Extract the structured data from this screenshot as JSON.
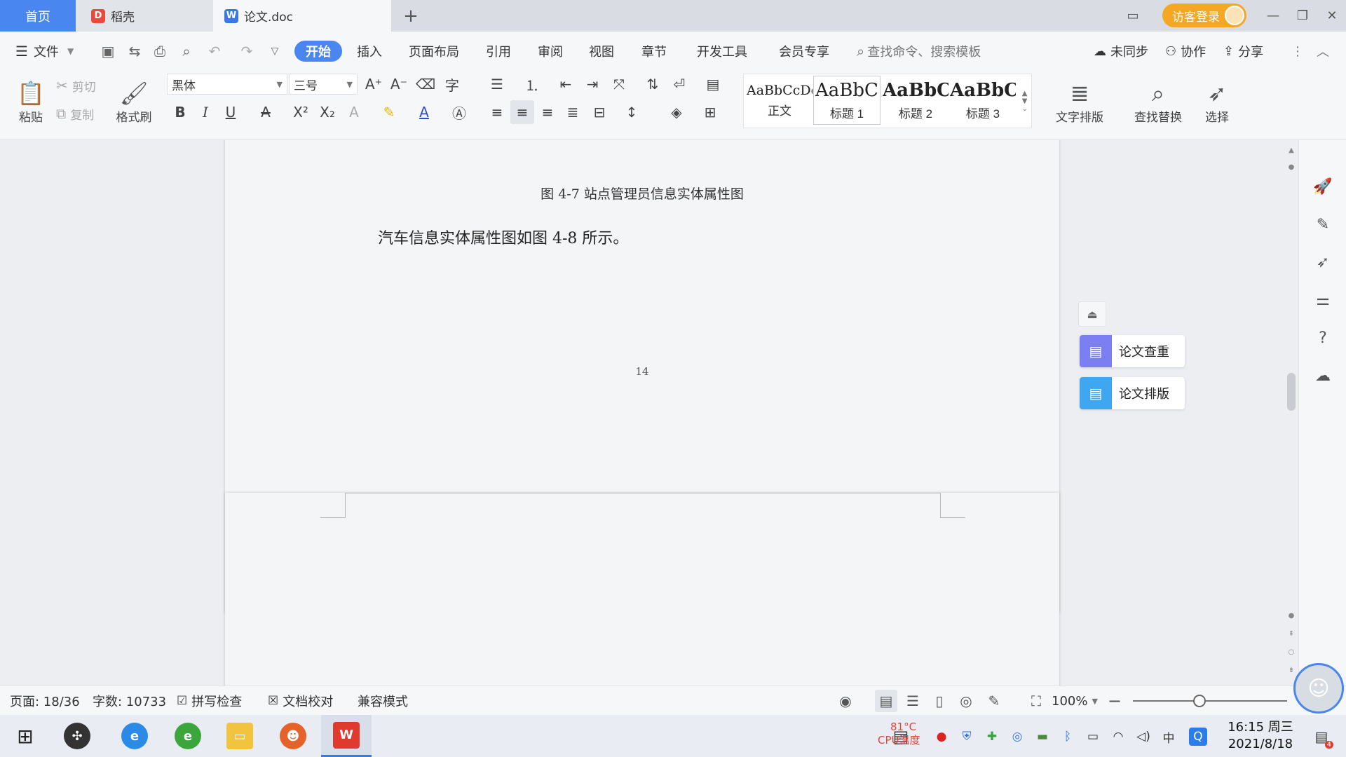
{
  "tabs": {
    "home": "首页",
    "docer": "稻壳",
    "doc": "论文.doc"
  },
  "window": {
    "login": "访客登录"
  },
  "menu": {
    "file": "文件",
    "start": "开始",
    "insert": "插入",
    "layout": "页面布局",
    "reference": "引用",
    "review": "审阅",
    "view": "视图",
    "chapter": "章节",
    "devtools": "开发工具",
    "member": "会员专享",
    "search_placeholder": "查找命令、搜索模板",
    "unsync": "未同步",
    "collab": "协作",
    "share": "分享"
  },
  "ribbon": {
    "paste": "粘贴",
    "cut": "剪切",
    "copy": "复制",
    "format_painter": "格式刷",
    "font": "黑体",
    "font_size": "三号",
    "styles": [
      {
        "sample": "AaBbCcDd",
        "name": "正文"
      },
      {
        "sample": "AaBbC",
        "name": "标题 1"
      },
      {
        "sample": "AaBbC",
        "name": "标题 2"
      },
      {
        "sample": "AaBbC",
        "name": "标题 3"
      }
    ],
    "text_layout": "文字排版",
    "find_replace": "查找替换",
    "select": "选择"
  },
  "document": {
    "caption": "图 4-7 站点管理员信息实体属性图",
    "paragraph": "汽车信息实体属性图如图 4-8 所示。",
    "page_number": "14"
  },
  "side_panel": {
    "check": "论文查重",
    "typeset": "论文排版"
  },
  "status": {
    "page": "页面: 18/36",
    "words": "字数: 10733",
    "spell": "拼写检查",
    "proof": "文档校对",
    "compat": "兼容模式",
    "zoom": "100%",
    "zoom_level": 0.43
  },
  "taskbar": {
    "cpu_temp": "81°C",
    "cpu_label": "CPU温度",
    "ime": "中",
    "time": "16:15 周三",
    "date": "2021/8/18",
    "notif_count": "4"
  }
}
